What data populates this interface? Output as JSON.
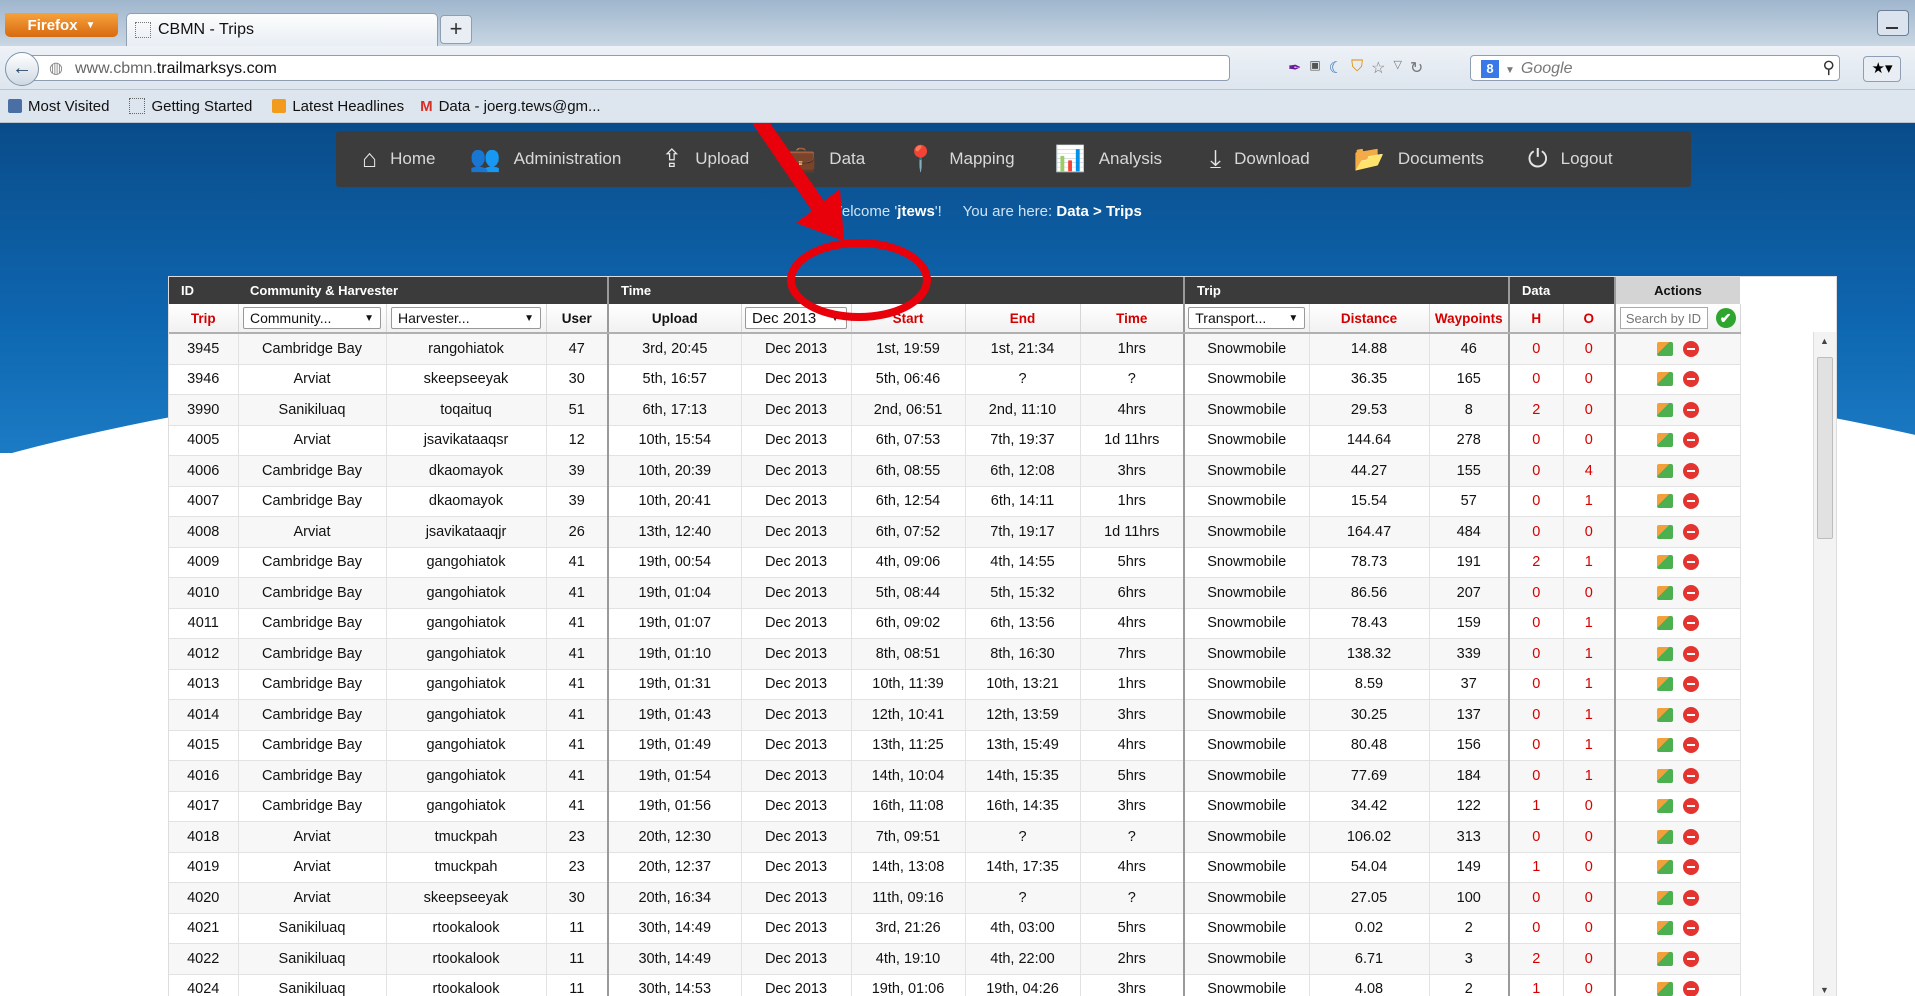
{
  "browser": {
    "menu_button": "Firefox",
    "tab_title": "CBMN - Trips",
    "new_tab": "+",
    "url_prefix": "www.cbmn.",
    "url_domain": "trailmarksys.com",
    "search_placeholder": "Google",
    "bookmarks": [
      {
        "label": "Most Visited",
        "icon": "bookmarks-icon"
      },
      {
        "label": "Getting Started",
        "icon": "page-icon"
      },
      {
        "label": "Latest Headlines",
        "icon": "rss-icon"
      },
      {
        "label": "Data - joerg.tews@gm...",
        "icon": "gmail-icon"
      }
    ]
  },
  "nav": {
    "items": [
      {
        "label": "Home",
        "icon": "home-icon"
      },
      {
        "label": "Administration",
        "icon": "users-icon"
      },
      {
        "label": "Upload",
        "icon": "upload-icon"
      },
      {
        "label": "Data",
        "icon": "briefcase-icon"
      },
      {
        "label": "Mapping",
        "icon": "map-pin-icon"
      },
      {
        "label": "Analysis",
        "icon": "bar-chart-icon"
      },
      {
        "label": "Download",
        "icon": "download-icon"
      },
      {
        "label": "Documents",
        "icon": "folder-icon"
      },
      {
        "label": "Logout",
        "icon": "power-icon"
      }
    ]
  },
  "welcome": {
    "prefix": "Welcome '",
    "user": "jtews",
    "suffix": "'!",
    "location_prefix": "You are here: ",
    "location": "Data > Trips"
  },
  "annotation": {
    "color": "#e8000b"
  },
  "table": {
    "groups": {
      "id": "ID",
      "community": "Community & Harvester",
      "time": "Time",
      "trip": "Trip",
      "data": "Data",
      "actions": "Actions"
    },
    "headers": {
      "trip": "Trip",
      "community_select": "Community...",
      "harvester_select": "Harvester...",
      "user": "User",
      "upload": "Upload",
      "month_select": "Dec 2013",
      "start": "Start",
      "end": "End",
      "time": "Time",
      "transport_select": "Transport...",
      "distance": "Distance",
      "waypoints": "Waypoints",
      "h": "H",
      "o": "O",
      "search_placeholder": "Search by ID"
    },
    "rows": [
      [
        "3945",
        "Cambridge Bay",
        "rangohiatok",
        "47",
        "3rd, 20:45",
        "Dec 2013",
        "1st, 19:59",
        "1st, 21:34",
        "1hrs",
        "Snowmobile",
        "14.88",
        "46",
        "0",
        "0"
      ],
      [
        "3946",
        "Arviat",
        "skeepseeyak",
        "30",
        "5th, 16:57",
        "Dec 2013",
        "5th, 06:46",
        "?",
        "?",
        "Snowmobile",
        "36.35",
        "165",
        "0",
        "0"
      ],
      [
        "3990",
        "Sanikiluaq",
        "toqaituq",
        "51",
        "6th, 17:13",
        "Dec 2013",
        "2nd, 06:51",
        "2nd, 11:10",
        "4hrs",
        "Snowmobile",
        "29.53",
        "8",
        "2",
        "0"
      ],
      [
        "4005",
        "Arviat",
        "jsavikataaqsr",
        "12",
        "10th, 15:54",
        "Dec 2013",
        "6th, 07:53",
        "7th, 19:37",
        "1d 11hrs",
        "Snowmobile",
        "144.64",
        "278",
        "0",
        "0"
      ],
      [
        "4006",
        "Cambridge Bay",
        "dkaomayok",
        "39",
        "10th, 20:39",
        "Dec 2013",
        "6th, 08:55",
        "6th, 12:08",
        "3hrs",
        "Snowmobile",
        "44.27",
        "155",
        "0",
        "4"
      ],
      [
        "4007",
        "Cambridge Bay",
        "dkaomayok",
        "39",
        "10th, 20:41",
        "Dec 2013",
        "6th, 12:54",
        "6th, 14:11",
        "1hrs",
        "Snowmobile",
        "15.54",
        "57",
        "0",
        "1"
      ],
      [
        "4008",
        "Arviat",
        "jsavikataaqjr",
        "26",
        "13th, 12:40",
        "Dec 2013",
        "6th, 07:52",
        "7th, 19:17",
        "1d 11hrs",
        "Snowmobile",
        "164.47",
        "484",
        "0",
        "0"
      ],
      [
        "4009",
        "Cambridge Bay",
        "gangohiatok",
        "41",
        "19th, 00:54",
        "Dec 2013",
        "4th, 09:06",
        "4th, 14:55",
        "5hrs",
        "Snowmobile",
        "78.73",
        "191",
        "2",
        "1"
      ],
      [
        "4010",
        "Cambridge Bay",
        "gangohiatok",
        "41",
        "19th, 01:04",
        "Dec 2013",
        "5th, 08:44",
        "5th, 15:32",
        "6hrs",
        "Snowmobile",
        "86.56",
        "207",
        "0",
        "0"
      ],
      [
        "4011",
        "Cambridge Bay",
        "gangohiatok",
        "41",
        "19th, 01:07",
        "Dec 2013",
        "6th, 09:02",
        "6th, 13:56",
        "4hrs",
        "Snowmobile",
        "78.43",
        "159",
        "0",
        "1"
      ],
      [
        "4012",
        "Cambridge Bay",
        "gangohiatok",
        "41",
        "19th, 01:10",
        "Dec 2013",
        "8th, 08:51",
        "8th, 16:30",
        "7hrs",
        "Snowmobile",
        "138.32",
        "339",
        "0",
        "1"
      ],
      [
        "4013",
        "Cambridge Bay",
        "gangohiatok",
        "41",
        "19th, 01:31",
        "Dec 2013",
        "10th, 11:39",
        "10th, 13:21",
        "1hrs",
        "Snowmobile",
        "8.59",
        "37",
        "0",
        "1"
      ],
      [
        "4014",
        "Cambridge Bay",
        "gangohiatok",
        "41",
        "19th, 01:43",
        "Dec 2013",
        "12th, 10:41",
        "12th, 13:59",
        "3hrs",
        "Snowmobile",
        "30.25",
        "137",
        "0",
        "1"
      ],
      [
        "4015",
        "Cambridge Bay",
        "gangohiatok",
        "41",
        "19th, 01:49",
        "Dec 2013",
        "13th, 11:25",
        "13th, 15:49",
        "4hrs",
        "Snowmobile",
        "80.48",
        "156",
        "0",
        "1"
      ],
      [
        "4016",
        "Cambridge Bay",
        "gangohiatok",
        "41",
        "19th, 01:54",
        "Dec 2013",
        "14th, 10:04",
        "14th, 15:35",
        "5hrs",
        "Snowmobile",
        "77.69",
        "184",
        "0",
        "1"
      ],
      [
        "4017",
        "Cambridge Bay",
        "gangohiatok",
        "41",
        "19th, 01:56",
        "Dec 2013",
        "16th, 11:08",
        "16th, 14:35",
        "3hrs",
        "Snowmobile",
        "34.42",
        "122",
        "1",
        "0"
      ],
      [
        "4018",
        "Arviat",
        "tmuckpah",
        "23",
        "20th, 12:30",
        "Dec 2013",
        "7th, 09:51",
        "?",
        "?",
        "Snowmobile",
        "106.02",
        "313",
        "0",
        "0"
      ],
      [
        "4019",
        "Arviat",
        "tmuckpah",
        "23",
        "20th, 12:37",
        "Dec 2013",
        "14th, 13:08",
        "14th, 17:35",
        "4hrs",
        "Snowmobile",
        "54.04",
        "149",
        "1",
        "0"
      ],
      [
        "4020",
        "Arviat",
        "skeepseeyak",
        "30",
        "20th, 16:34",
        "Dec 2013",
        "11th, 09:16",
        "?",
        "?",
        "Snowmobile",
        "27.05",
        "100",
        "0",
        "0"
      ],
      [
        "4021",
        "Sanikiluaq",
        "rtookalook",
        "11",
        "30th, 14:49",
        "Dec 2013",
        "3rd, 21:26",
        "4th, 03:00",
        "5hrs",
        "Snowmobile",
        "0.02",
        "2",
        "0",
        "0"
      ],
      [
        "4022",
        "Sanikiluaq",
        "rtookalook",
        "11",
        "30th, 14:49",
        "Dec 2013",
        "4th, 19:10",
        "4th, 22:00",
        "2hrs",
        "Snowmobile",
        "6.71",
        "3",
        "2",
        "0"
      ],
      [
        "4024",
        "Sanikiluaq",
        "rtookalook",
        "11",
        "30th, 14:53",
        "Dec 2013",
        "19th, 01:06",
        "19th, 04:26",
        "3hrs",
        "Snowmobile",
        "4.08",
        "2",
        "1",
        "0"
      ]
    ]
  }
}
